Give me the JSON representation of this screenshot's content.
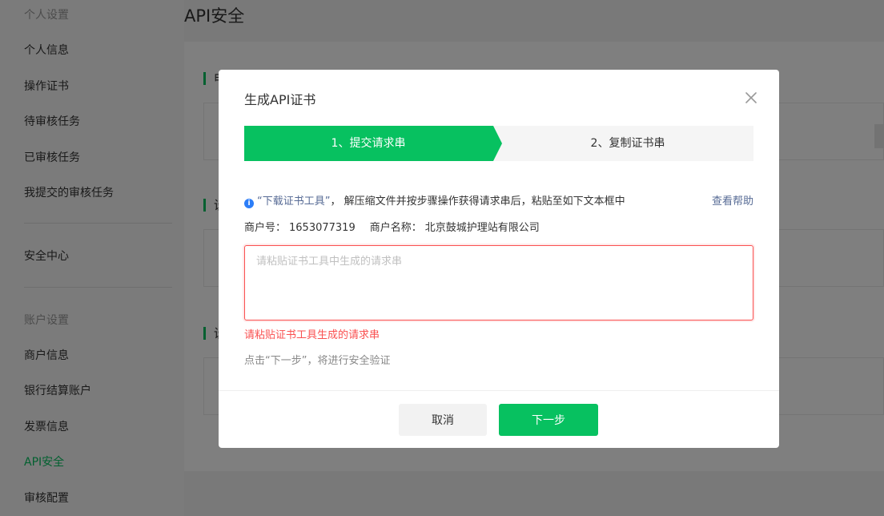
{
  "sidebar": {
    "personal_section": "个人设置",
    "items_personal": [
      "个人信息",
      "操作证书",
      "待审核任务",
      "已审核任务",
      "我提交的审核任务"
    ],
    "security_center": "安全中心",
    "account_section": "账户设置",
    "items_account": [
      "商户信息",
      "银行结算账户",
      "发票信息",
      "API安全",
      "审核配置"
    ]
  },
  "page": {
    "title": "API安全",
    "section_initials": [
      "申",
      "设",
      "设"
    ]
  },
  "modal": {
    "title": "生成API证书",
    "steps": [
      "1、提交请求串",
      "2、复制证书串"
    ],
    "notice_link": "“下载证书工具”",
    "notice_text": "， 解压缩文件并按步骤操作获得请求串后，粘贴至如下文本框中",
    "help_link": "查看帮助",
    "merchant_id_label": "商户号：",
    "merchant_id": "1653077319",
    "merchant_name_label": "商户名称：",
    "merchant_name": "北京鼓城护理站有限公司",
    "input_placeholder": "请粘贴证书工具中生成的请求串",
    "input_value": "",
    "error_text": "请粘贴证书工具生成的请求串",
    "hint_text": "点击“下一步”，将进行安全验证",
    "cancel_label": "取消",
    "next_label": "下一步"
  },
  "colors": {
    "accent": "#07c160",
    "error": "#fa5151",
    "link": "#576b95",
    "info": "#2c7ef8"
  },
  "icons": {
    "close": "close-icon",
    "info": "info-icon"
  }
}
